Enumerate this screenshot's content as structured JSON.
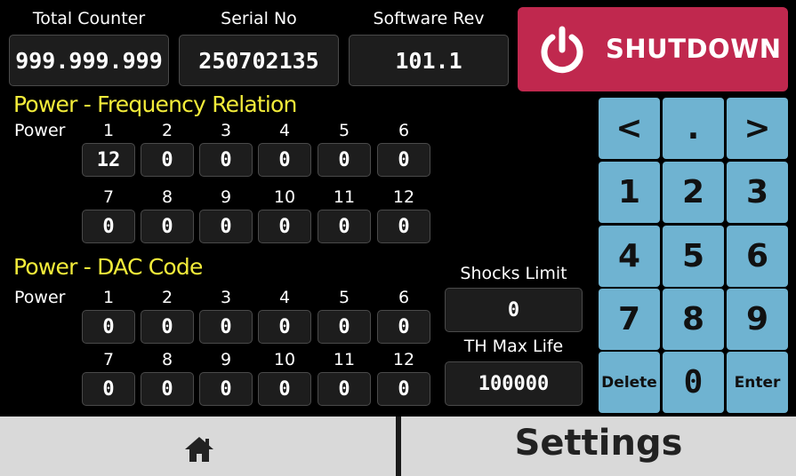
{
  "header": {
    "total_counter_label": "Total Counter",
    "total_counter_value": "999.999.999",
    "serial_label": "Serial No",
    "serial_value": "250702135",
    "software_label": "Software Rev",
    "software_value": "101.1",
    "shutdown_label": "SHUTDOWN",
    "shutdown_icon": "power-icon"
  },
  "freq": {
    "title": "Power - Frequency Relation",
    "power_label": "Power",
    "cols_row1": [
      "1",
      "2",
      "3",
      "4",
      "5",
      "6"
    ],
    "vals_row1": [
      "12",
      "0",
      "0",
      "0",
      "0",
      "0"
    ],
    "cols_row2": [
      "7",
      "8",
      "9",
      "10",
      "11",
      "12"
    ],
    "vals_row2": [
      "0",
      "0",
      "0",
      "0",
      "0",
      "0"
    ]
  },
  "dac": {
    "title": "Power - DAC Code",
    "power_label": "Power",
    "cols_row1": [
      "1",
      "2",
      "3",
      "4",
      "5",
      "6"
    ],
    "vals_row1": [
      "0",
      "0",
      "0",
      "0",
      "0",
      "0"
    ],
    "cols_row2": [
      "7",
      "8",
      "9",
      "10",
      "11",
      "12"
    ],
    "vals_row2": [
      "0",
      "0",
      "0",
      "0",
      "0",
      "0"
    ]
  },
  "side": {
    "shocks_label": "Shocks Limit",
    "shocks_value": "0",
    "th_label": "TH Max Life",
    "th_value": "100000"
  },
  "keypad": {
    "keys": [
      "<",
      ".",
      ">",
      "1",
      "2",
      "3",
      "4",
      "5",
      "6",
      "7",
      "8",
      "9",
      "Delete",
      "0",
      "Enter"
    ]
  },
  "footer": {
    "home_icon": "home-icon",
    "settings_label": "Settings"
  },
  "colors": {
    "background": "#000000",
    "title_yellow": "#f3ec3a",
    "shutdown_red": "#c0284e",
    "keypad_blue": "#6fb3d1",
    "footer_gray": "#d9d9d9"
  }
}
